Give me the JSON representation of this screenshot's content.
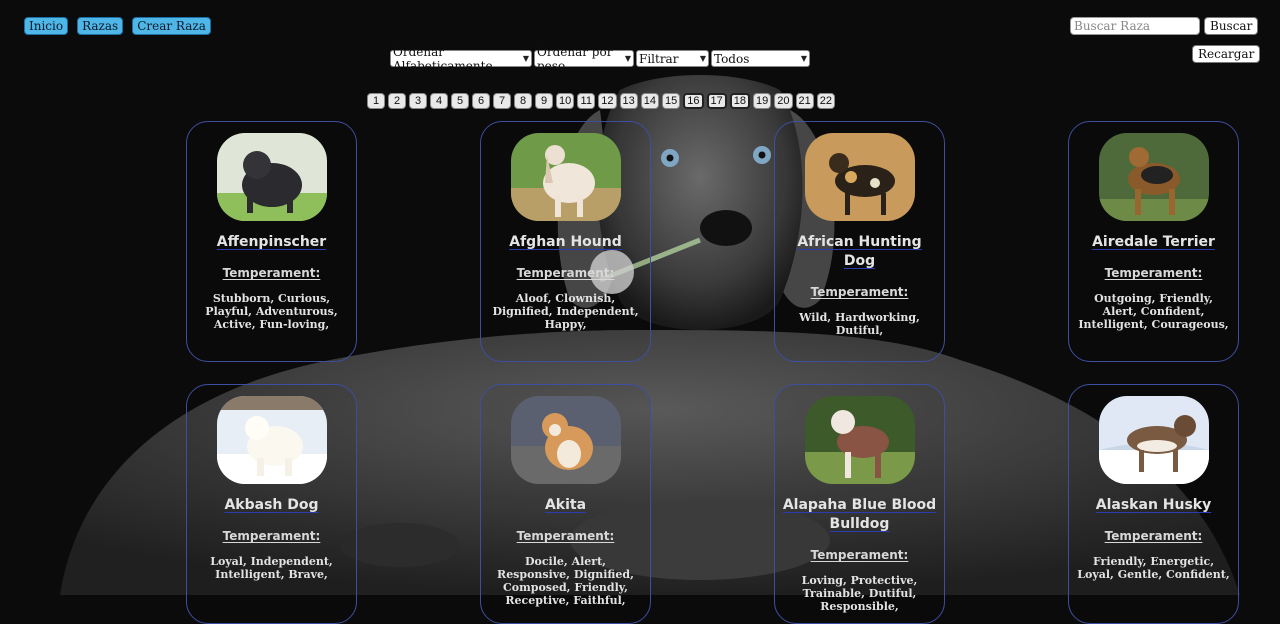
{
  "nav": {
    "home": "Inicio",
    "breeds": "Razas",
    "create": "Crear Raza"
  },
  "search": {
    "placeholder": "Buscar Raza",
    "value": "",
    "button": "Buscar"
  },
  "reload": "Recargar",
  "sort": {
    "alpha": "Ordenar Alfabeticamente",
    "weight": "Ordenar por peso",
    "filter": "Filtrar",
    "source": "Todos"
  },
  "pagination": {
    "pages": [
      "1",
      "2",
      "3",
      "4",
      "5",
      "6",
      "7",
      "8",
      "9",
      "10",
      "11",
      "12",
      "13",
      "14",
      "15",
      "16",
      "17",
      "18",
      "19",
      "20",
      "21",
      "22"
    ]
  },
  "cards": [
    {
      "name": "Affenpinscher",
      "temperament_label": "Temperament:",
      "temperament": "Stubborn, Curious, Playful, Adventurous, Active, Fun-loving,"
    },
    {
      "name": "Afghan Hound",
      "temperament_label": "Temperament:",
      "temperament": "Aloof, Clownish, Dignified, Independent, Happy,"
    },
    {
      "name": "African Hunting Dog",
      "temperament_label": "Temperament:",
      "temperament": "Wild, Hardworking, Dutiful,"
    },
    {
      "name": "Airedale Terrier",
      "temperament_label": "Temperament:",
      "temperament": "Outgoing, Friendly, Alert, Confident, Intelligent, Courageous,"
    },
    {
      "name": "Akbash Dog",
      "temperament_label": "Temperament:",
      "temperament": "Loyal, Independent, Intelligent, Brave,"
    },
    {
      "name": "Akita",
      "temperament_label": "Temperament:",
      "temperament": "Docile, Alert, Responsive, Dignified, Composed, Friendly, Receptive, Faithful,"
    },
    {
      "name": "Alapaha Blue Blood Bulldog",
      "temperament_label": "Temperament:",
      "temperament": "Loving, Protective, Trainable, Dutiful, Responsible,"
    },
    {
      "name": "Alaskan Husky",
      "temperament_label": "Temperament:",
      "temperament": "Friendly, Energetic, Loyal, Gentle, Confident,"
    }
  ],
  "colors": {
    "accent": "#4fb6e8",
    "card_border": "#3d4fa0",
    "background": "#0b0b0b"
  }
}
